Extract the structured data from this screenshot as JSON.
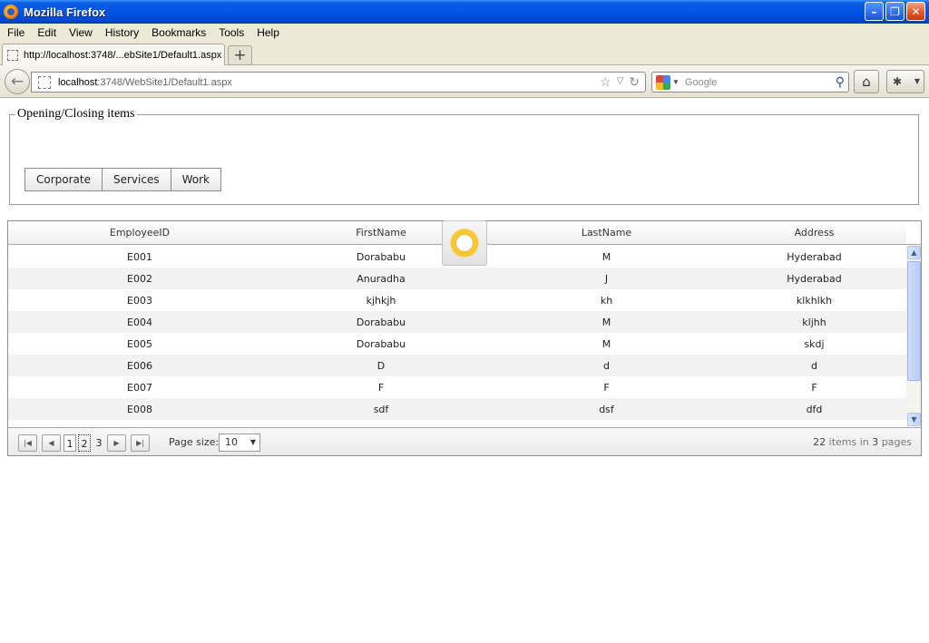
{
  "window": {
    "title": "Mozilla Firefox",
    "minimize": "–",
    "restore": "❐",
    "close": "✕"
  },
  "menubar": [
    {
      "label": "File"
    },
    {
      "label": "Edit"
    },
    {
      "label": "View"
    },
    {
      "label": "History"
    },
    {
      "label": "Bookmarks"
    },
    {
      "label": "Tools"
    },
    {
      "label": "Help"
    }
  ],
  "tab": {
    "label": "http://localhost:3748/...ebSite1/Default1.aspx",
    "new_tab": "+"
  },
  "navbar": {
    "url_host": "localhost",
    "url_rest": ":3748/WebSite1/Default1.aspx",
    "search_placeholder": "Google",
    "icons": [
      "back-arrow-icon",
      "bookmark-star-icon",
      "reload-icon",
      "search-icon",
      "home-icon",
      "addon-icon"
    ]
  },
  "panel": {
    "legend": "Opening/Closing items",
    "menu_items": [
      "Corporate",
      "Services",
      "Work"
    ]
  },
  "grid": {
    "columns": [
      "EmployeeID",
      "FirstName",
      "LastName",
      "Address"
    ],
    "rows": [
      [
        "E001",
        "Dorababu",
        "M",
        "Hyderabad"
      ],
      [
        "E002",
        "Anuradha",
        "J",
        "Hyderabad"
      ],
      [
        "E003",
        "kjhkjh",
        "kh",
        "klkhlkh"
      ],
      [
        "E004",
        "Dorababu",
        "M",
        "kljhh"
      ],
      [
        "E005",
        "Dorababu",
        "M",
        "skdj"
      ],
      [
        "E006",
        "D",
        "d",
        "d"
      ],
      [
        "E007",
        "F",
        "F",
        "F"
      ],
      [
        "E008",
        "sdf",
        "dsf",
        "dfd"
      ]
    ],
    "pager": {
      "pages": [
        "1",
        "2",
        "3"
      ],
      "current_page": "1",
      "page_size_label": "Page size:",
      "page_size": "10",
      "total_items": "22",
      "items_in": "items in",
      "total_pages": "3",
      "pages_word": "pages"
    },
    "scroll_position": 0
  },
  "colors": {
    "titlebar": "#0155e5",
    "chrome": "#ece9d8",
    "loader_ring": "#f7c835",
    "grid_alt_row": "#f2f2f2"
  }
}
